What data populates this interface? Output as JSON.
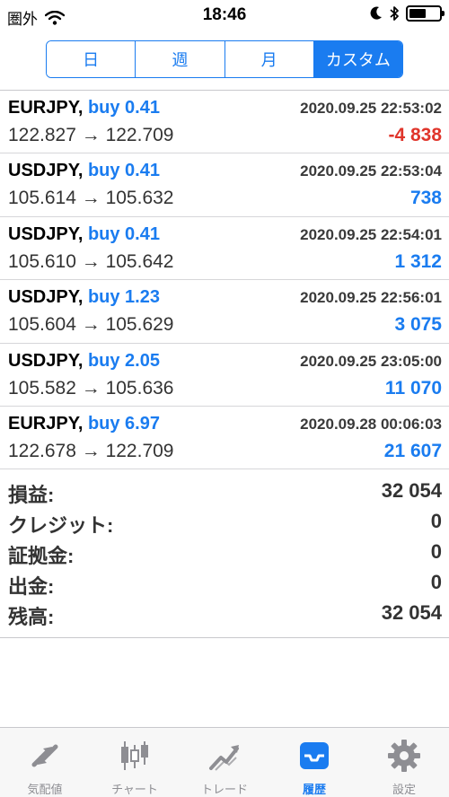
{
  "status_bar": {
    "carrier": "圏外",
    "time": "18:46"
  },
  "period_tabs": [
    {
      "label": "日",
      "active": false
    },
    {
      "label": "週",
      "active": false
    },
    {
      "label": "月",
      "active": false
    },
    {
      "label": "カスタム",
      "active": true
    }
  ],
  "trades": [
    {
      "symbol": "EURJPY,",
      "action": "buy 0.41",
      "time": "2020.09.25 22:53:02",
      "prices": "122.827 → 122.709",
      "profit": "-4 838",
      "profit_sign": "neg"
    },
    {
      "symbol": "USDJPY,",
      "action": "buy 0.41",
      "time": "2020.09.25 22:53:04",
      "prices": "105.614 → 105.632",
      "profit": "738",
      "profit_sign": "pos"
    },
    {
      "symbol": "USDJPY,",
      "action": "buy 0.41",
      "time": "2020.09.25 22:54:01",
      "prices": "105.610 → 105.642",
      "profit": "1 312",
      "profit_sign": "pos"
    },
    {
      "symbol": "USDJPY,",
      "action": "buy 1.23",
      "time": "2020.09.25 22:56:01",
      "prices": "105.604 → 105.629",
      "profit": "3 075",
      "profit_sign": "pos"
    },
    {
      "symbol": "USDJPY,",
      "action": "buy 2.05",
      "time": "2020.09.25 23:05:00",
      "prices": "105.582 → 105.636",
      "profit": "11 070",
      "profit_sign": "pos"
    },
    {
      "symbol": "EURJPY,",
      "action": "buy 6.97",
      "time": "2020.09.28 00:06:03",
      "prices": "122.678 → 122.709",
      "profit": "21 607",
      "profit_sign": "pos"
    }
  ],
  "summary": [
    {
      "label": "損益:",
      "value": "32 054"
    },
    {
      "label": "クレジット:",
      "value": "0"
    },
    {
      "label": "証拠金:",
      "value": "0"
    },
    {
      "label": "出金:",
      "value": "0"
    },
    {
      "label": "残高:",
      "value": "32 054"
    }
  ],
  "tab_bar": [
    {
      "label": "気配値",
      "icon": "quotes-icon",
      "active": false
    },
    {
      "label": "チャート",
      "icon": "chart-icon",
      "active": false
    },
    {
      "label": "トレード",
      "icon": "trade-icon",
      "active": false
    },
    {
      "label": "履歴",
      "icon": "history-icon",
      "active": true
    },
    {
      "label": "設定",
      "icon": "settings-icon",
      "active": false
    }
  ],
  "colors": {
    "accent": "#1a7cf0",
    "loss": "#e0352b",
    "inactive": "#8e8e93"
  }
}
